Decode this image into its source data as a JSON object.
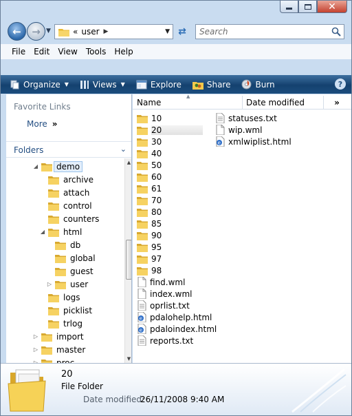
{
  "window": {
    "buttons": {
      "minimize_icon": "minimize-icon",
      "maximize_icon": "maximize-icon",
      "close_glyph": "✕"
    }
  },
  "nav": {
    "address_prefix": "«",
    "address_current": "user",
    "search_placeholder": "Search"
  },
  "menubar": {
    "items": [
      "File",
      "Edit",
      "View",
      "Tools",
      "Help"
    ]
  },
  "toolbar": {
    "organize": "Organize",
    "views": "Views",
    "explore": "Explore",
    "share": "Share",
    "burn": "Burn",
    "help_glyph": "?"
  },
  "navpane": {
    "favorite_links_title": "Favorite Links",
    "more": "More",
    "more_chevron": "»",
    "folders_title": "Folders",
    "tree": [
      {
        "label": "demo",
        "expander": "◢"
      },
      {
        "label": "archive",
        "expander": ""
      },
      {
        "label": "attach",
        "expander": ""
      },
      {
        "label": "control",
        "expander": ""
      },
      {
        "label": "counters",
        "expander": ""
      },
      {
        "label": "html",
        "expander": "◢"
      },
      {
        "label": "db",
        "expander": ""
      },
      {
        "label": "global",
        "expander": ""
      },
      {
        "label": "guest",
        "expander": ""
      },
      {
        "label": "user",
        "expander": "▷"
      },
      {
        "label": "logs",
        "expander": ""
      },
      {
        "label": "picklist",
        "expander": ""
      },
      {
        "label": "trlog",
        "expander": ""
      },
      {
        "label": "import",
        "expander": "▷"
      },
      {
        "label": "master",
        "expander": "▷"
      },
      {
        "label": "proc",
        "expander": "▷"
      }
    ]
  },
  "filelist": {
    "columns": {
      "name": "Name",
      "date": "Date modified",
      "more": "»"
    },
    "col1": [
      {
        "name": "10",
        "type": "folder"
      },
      {
        "name": "20",
        "type": "folder",
        "selected": true
      },
      {
        "name": "30",
        "type": "folder"
      },
      {
        "name": "40",
        "type": "folder"
      },
      {
        "name": "50",
        "type": "folder"
      },
      {
        "name": "60",
        "type": "folder"
      },
      {
        "name": "61",
        "type": "folder"
      },
      {
        "name": "70",
        "type": "folder"
      },
      {
        "name": "80",
        "type": "folder"
      },
      {
        "name": "85",
        "type": "folder"
      },
      {
        "name": "90",
        "type": "folder"
      },
      {
        "name": "95",
        "type": "folder"
      },
      {
        "name": "97",
        "type": "folder"
      },
      {
        "name": "98",
        "type": "folder"
      },
      {
        "name": "find.wml",
        "type": "file"
      },
      {
        "name": "index.wml",
        "type": "file"
      },
      {
        "name": "oprlist.txt",
        "type": "text"
      },
      {
        "name": "pdalohelp.html",
        "type": "html"
      },
      {
        "name": "pdaloindex.html",
        "type": "html"
      },
      {
        "name": "reports.txt",
        "type": "text"
      }
    ],
    "col2": [
      {
        "name": "statuses.txt",
        "type": "text"
      },
      {
        "name": "wip.wml",
        "type": "file"
      },
      {
        "name": "xmlwiplist.html",
        "type": "html"
      }
    ]
  },
  "details": {
    "name": "20",
    "type": "File Folder",
    "modified_label": "Date modified:",
    "modified_value": "26/11/2008 9:40 AM"
  },
  "colors": {
    "toolbar": "#1c4d7e",
    "link": "#234e82",
    "folder_yellow": "#f3c94b"
  }
}
